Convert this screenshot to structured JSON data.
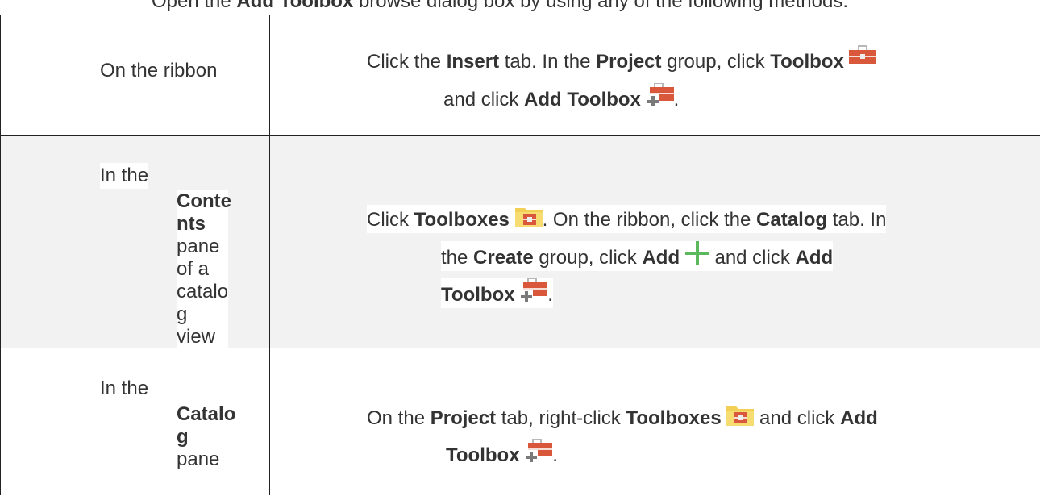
{
  "intro": {
    "pre": "Open the ",
    "bold": "Add Toolbox",
    "post": " browse dialog box by using any of the following methods:"
  },
  "rows": [
    {
      "method": "On the ribbon",
      "steps": {
        "t1": "Click the ",
        "b1": "Insert",
        "t2": " tab. In the ",
        "b2": "Project",
        "t3": " group, click ",
        "b3": "Toolbox",
        "t4": "and click ",
        "b4": "Add Toolbox",
        "t5": "."
      }
    },
    {
      "method": {
        "in_the": "In the",
        "name_part1": "Conte",
        "name_part2": "nts",
        "l1": "pane",
        "l2": "of a",
        "l3": "catalo",
        "l4": "g view"
      },
      "steps": {
        "t1": "Click ",
        "b1": "Toolboxes",
        "t2": ". On the ribbon, click the ",
        "b2": "Catalog",
        "t3": " tab. In",
        "t4": "the ",
        "b3": "Create",
        "t5": " group, click ",
        "b4": "Add",
        "t6": " and click ",
        "b5": "Add",
        "b6": "Toolbox",
        "t7": "."
      }
    },
    {
      "method": {
        "in_the": "In the",
        "name_part1": "Catalo",
        "name_part2": "g",
        "l1": "pane"
      },
      "steps": {
        "t1": "On the ",
        "b1": "Project",
        "t2": " tab, right-click ",
        "b2": "Toolboxes",
        "t3": " and click ",
        "b3": "Add",
        "b4": "Toolbox",
        "t4": "."
      }
    }
  ],
  "icons": {
    "toolbox": "toolbox-icon",
    "add_toolbox": "add-toolbox-icon",
    "toolboxes_folder": "toolboxes-folder-icon",
    "add": "add-plus-icon"
  },
  "colors": {
    "toolbox_red": "#d9573a",
    "folder_yellow": "#f2cf55",
    "plus_green": "#5cb85c",
    "shaded_row": "#f2f2f2"
  }
}
